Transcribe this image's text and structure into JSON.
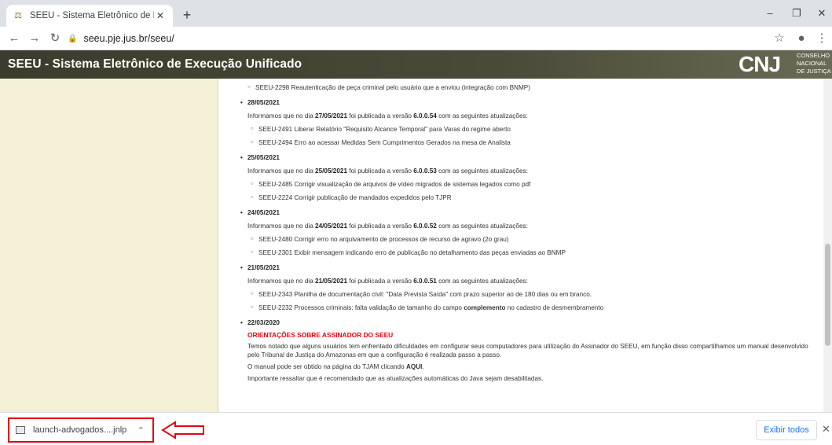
{
  "browser": {
    "tab_title": "SEEU - Sistema Eletrônico de Exe",
    "url": "seeu.pje.jus.br/seeu/"
  },
  "site": {
    "title": "SEEU - Sistema Eletrônico de Execução Unificado",
    "logo_text": "CNJ",
    "logo_sub": [
      "CONSELHO",
      "NACIONAL",
      "DE JUSTIÇA"
    ]
  },
  "content": {
    "first_item": "SEEU-2298 Reautenticação de peça criminal pelo usuário que a enviou (integração com BNMP)",
    "entries": [
      {
        "date": "28/05/2021",
        "intro_prefix": "Informamos que no dia ",
        "intro_date": "27/05/2021",
        "intro_mid": " foi publicada a versão ",
        "intro_version": "6.0.0.54",
        "intro_suffix": " com as seguintes atualizações:",
        "items": [
          "SEEU-2491 Liberar Relatório \"Requisito Alcance Temporal\" para Varas do regime aberto",
          "SEEU-2494 Erro ao acessar Medidas Sem Cumprimentos Gerados na mesa de Analista"
        ]
      },
      {
        "date": "25/05/2021",
        "intro_prefix": "Informamos que no dia ",
        "intro_date": "25/05/2021",
        "intro_mid": " foi publicada a versão ",
        "intro_version": "6.0.0.53",
        "intro_suffix": " com as seguintes atualizações:",
        "items": [
          "SEEU-2485 Corrigir visualização de arquivos de vídeo migrados de sistemas legados como pdf",
          "SEEU-2224 Corrigir publicação de mandados expedidos pelo TJPR"
        ]
      },
      {
        "date": "24/05/2021",
        "intro_prefix": "Informamos que no dia ",
        "intro_date": "24/05/2021",
        "intro_mid": " foi publicada a versão ",
        "intro_version": "6.0.0.52",
        "intro_suffix": " com as seguintes atualizações:",
        "items": [
          "SEEU-2480 Corrigir erro no arquivamento de processos de recurso de agravo (2o grau)",
          "SEEU-2301 Exibir mensagem indicando erro de publicação no detalhamento das peças enviadas ao BNMP"
        ]
      },
      {
        "date": "21/05/2021",
        "intro_prefix": "Informamos que no dia ",
        "intro_date": "21/05/2021",
        "intro_mid": " foi publicada a versão ",
        "intro_version": "6.0.0.51",
        "intro_suffix": " com as seguintes atualizações:",
        "items": [
          "SEEU-2343 Planilha de documentação civil: \"Data Prevista Saída\" com prazo superior ao de 180 dias ou em branco."
        ],
        "item_last_prefix": "SEEU-2232 Processos criminais: falta validação de tamanho do campo ",
        "item_last_bold": "complemento",
        "item_last_suffix": " no cadastro de desmembramento"
      }
    ],
    "last_entry": {
      "date": "22/03/2020",
      "heading": "ORIENTAÇÕES SOBRE ASSINADOR DO SEEU",
      "para1": "Temos notado que alguns usuários tem enfrentado dificuldades em configurar seus computadores para utilização do Assinador do SEEU, em função disso compartilhamos um manual desenvolvido pelo Tribunal de Justiça do Amazonas em que a configuração é realizada passo a passo.",
      "para2_prefix": "O manual pode ser obtido na página do TJAM clicando ",
      "para2_link": "AQUI",
      "para2_suffix": ".",
      "para3": "Importante ressaltar que é recomendado que as atualizações automáticas do Java sejam desabilitadas."
    }
  },
  "downloads": {
    "filename": "launch-advogados....jnlp",
    "show_all": "Exibir todos"
  },
  "colors": {
    "header_bg": "#3c3c2e",
    "left_panel": "#f4f1d7",
    "highlight_red": "#e30613",
    "link_blue": "#1a73e8"
  }
}
